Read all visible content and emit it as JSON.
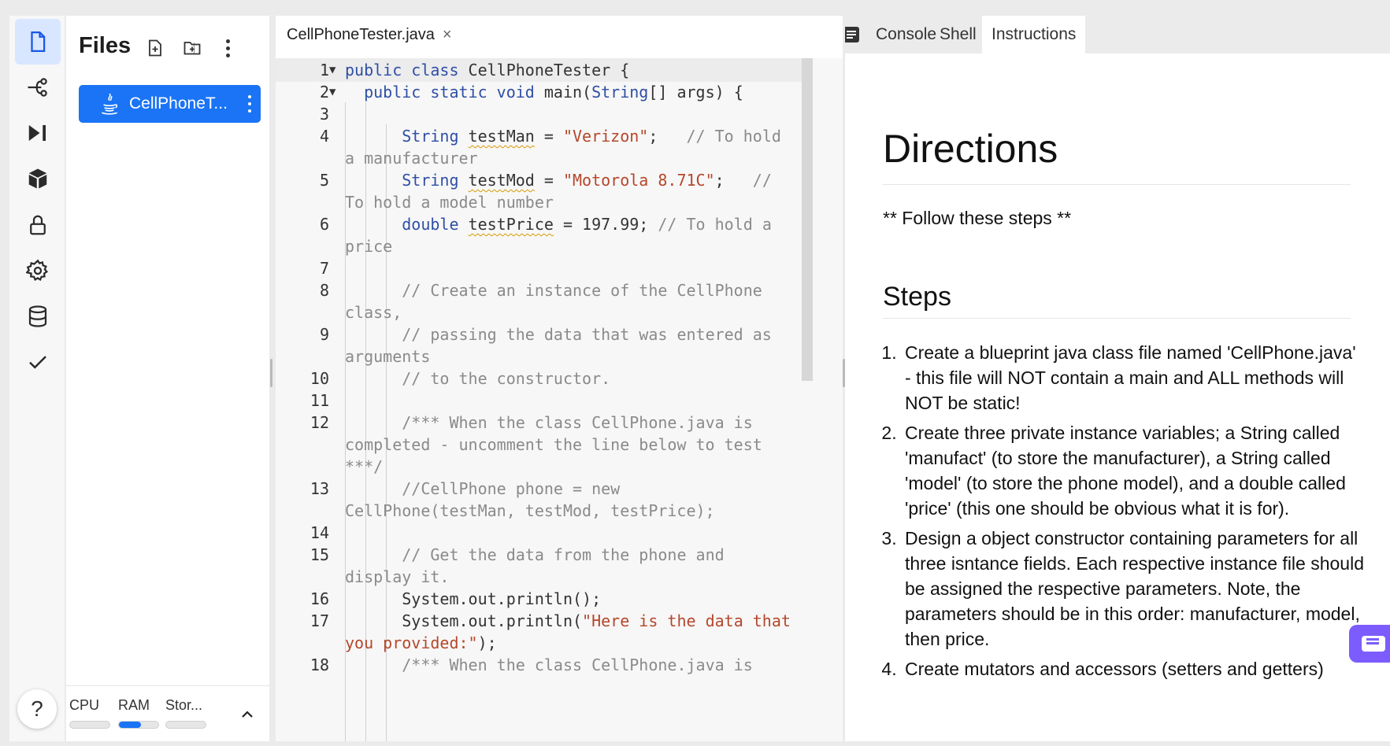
{
  "activity_bar": {
    "items": [
      {
        "name": "files-icon",
        "active": true
      },
      {
        "name": "version-control-icon",
        "active": false
      },
      {
        "name": "run-icon",
        "active": false
      },
      {
        "name": "packages-icon",
        "active": false
      },
      {
        "name": "secrets-lock-icon",
        "active": false
      },
      {
        "name": "settings-gear-icon",
        "active": false
      },
      {
        "name": "database-icon",
        "active": false
      },
      {
        "name": "tests-check-icon",
        "active": false
      }
    ],
    "help_label": "?"
  },
  "files": {
    "title": "Files",
    "items": [
      {
        "label": "CellPhoneT...",
        "icon": "java-icon",
        "selected": true
      }
    ],
    "resources": [
      {
        "label": "CPU",
        "level": 0.0
      },
      {
        "label": "RAM",
        "level": 0.55
      },
      {
        "label": "Stor...",
        "level": 0.0
      }
    ]
  },
  "editor": {
    "tab_label": "CellPhoneTester.java",
    "tab_close": "×",
    "lines": [
      {
        "no": "1",
        "fold": "▼"
      },
      {
        "no": "2",
        "fold": "▼"
      },
      {
        "no": "3",
        "fold": ""
      },
      {
        "no": "4",
        "fold": ""
      },
      {
        "no": "5",
        "fold": ""
      },
      {
        "no": "6",
        "fold": ""
      },
      {
        "no": "7",
        "fold": ""
      },
      {
        "no": "8",
        "fold": ""
      },
      {
        "no": "9",
        "fold": ""
      },
      {
        "no": "10",
        "fold": ""
      },
      {
        "no": "11",
        "fold": ""
      },
      {
        "no": "12",
        "fold": ""
      },
      {
        "no": "13",
        "fold": ""
      },
      {
        "no": "14",
        "fold": ""
      },
      {
        "no": "15",
        "fold": ""
      },
      {
        "no": "16",
        "fold": ""
      },
      {
        "no": "17",
        "fold": ""
      },
      {
        "no": "18",
        "fold": ""
      }
    ],
    "code": {
      "l1_kw": "public class",
      "l1_rest": " CellPhoneTester {",
      "l2_kw": "public static void",
      "l2_rest": " main(",
      "l2_type": "String",
      "l2_rest2": "[] args) {",
      "l4_type": "String",
      "l4_var": "testMan",
      "l4_eq": " = ",
      "l4_str": "\"Verizon\"",
      "l4_semi": ";   ",
      "l4_cm1": "// To hold",
      "l4_cm2": "a manufacturer",
      "l5_type": "String",
      "l5_var": "testMod",
      "l5_eq": " = ",
      "l5_str": "\"Motorola 8.71C\"",
      "l5_semi": ";   ",
      "l5_cm1": "//",
      "l5_cm2": "To hold a model number",
      "l6_type": "double",
      "l6_var": "testPrice",
      "l6_eq": " = 197.99; ",
      "l6_cm1": "// To hold a",
      "l6_cm2": "price",
      "l8_cm1": "// Create an instance of the CellPhone",
      "l8_cm2": "class,",
      "l9_cm1": "// passing the data that was entered as",
      "l9_cm2": "arguments",
      "l10_cm": "// to the constructor.",
      "l12_cm1": "/*** When the class CellPhone.java is",
      "l12_cm2": "completed - uncomment the line below to test",
      "l12_cm3": "***/",
      "l13_cm1": "//CellPhone phone = new",
      "l13_cm2": "CellPhone(testMan, testMod, testPrice);",
      "l15_cm1": "// Get the data from the phone and",
      "l15_cm2": "display it.",
      "l16": "System.out.println();",
      "l17_a": "System.out.println(",
      "l17_str1": "\"Here is the data that",
      "l17_str2": "you provided:\"",
      "l17_b": ");",
      "l18_cm": "/*** When the class CellPhone.java is"
    }
  },
  "right_panel": {
    "tabs": [
      {
        "label": "Console",
        "active": false
      },
      {
        "label": "Shell",
        "active": false
      },
      {
        "label": "Instructions",
        "active": true
      }
    ],
    "heading": "Directions",
    "intro": "** Follow these steps **",
    "subheading": "Steps",
    "steps": [
      "Create a blueprint java class file named 'CellPhone.java' - this file will NOT contain a main and ALL methods will NOT be static!",
      "Create three private instance variables; a String called 'manufact' (to store the manufacturer), a String called 'model' (to store the phone model), and a double called 'price' (this one should be obvious what it is for).",
      "Design a object constructor containing parameters for all three isntance fields. Each respective instance file should be assigned the respective parameters. Note, the parameters should be in this order: manufacturer, model, then price.",
      "Create mutators and accessors (setters and getters)"
    ]
  },
  "colors": {
    "accent": "#1a74f5",
    "active_icon_bg": "#d9e6ff",
    "chat": "#7c5cff"
  }
}
